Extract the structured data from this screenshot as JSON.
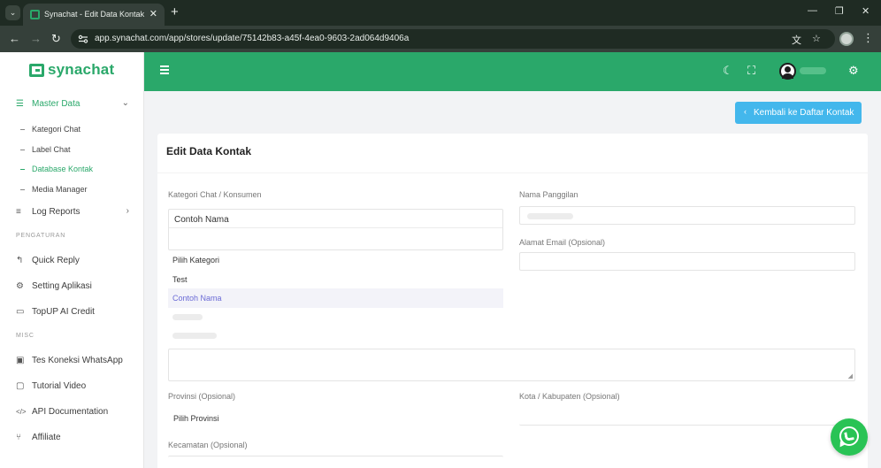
{
  "browser": {
    "tab_title": "Synachat - Edit Data Kontak",
    "url": "app.synachat.com/app/stores/update/75142b83-a45f-4ea0-9603-2ad064d9406a",
    "new_tab": "+",
    "tab_close": "✕",
    "back": "←",
    "forward": "→",
    "reload": "↻",
    "minimize": "—",
    "restore": "❐",
    "close": "✕",
    "menu": "⋮",
    "tab_list": "⌄",
    "translate_icon": "文",
    "bookmark_icon": "☆"
  },
  "brand": {
    "name": "synachat",
    "color": "#2aa86a"
  },
  "sidebar": {
    "master_data": {
      "label": "Master Data",
      "chevron": "⌄"
    },
    "sub_items": [
      {
        "label": "Kategori Chat"
      },
      {
        "label": "Label Chat"
      },
      {
        "label": "Database Kontak"
      },
      {
        "label": "Media Manager"
      }
    ],
    "log_reports": {
      "label": "Log Reports",
      "chevron": "›"
    },
    "section_pengaturan": "PENGATURAN",
    "quick_reply": "Quick Reply",
    "setting_aplikasi": "Setting Aplikasi",
    "topup": "TopUP AI Credit",
    "section_misc": "MISC",
    "tes_koneksi": "Tes Koneksi WhatsApp",
    "tutorial": "Tutorial Video",
    "api_doc": "API Documentation",
    "affiliate": "Affiliate"
  },
  "icons": {
    "master": "☰",
    "log": "≡",
    "quick": "↰",
    "gear": "⚙",
    "card": "▭",
    "chat": "▣",
    "video": "▢",
    "code": "</>",
    "share": "⑂",
    "moon": "☾",
    "fullscreen": "⛶"
  },
  "header": {
    "menu_icon": "hamburger-icon"
  },
  "main": {
    "back_button": "Kembali ke Daftar Kontak",
    "back_arrow": "‹",
    "card_title": "Edit Data Kontak",
    "kategori_label": "Kategori Chat / Konsumen",
    "kategori_value": "Contoh Nama",
    "kategori_options": [
      {
        "label": "Pilih Kategori"
      },
      {
        "label": "Test"
      },
      {
        "label": "Contoh Nama"
      }
    ],
    "nama_label": "Nama Panggilan",
    "email_label": "Alamat Email (Opsional)",
    "provinsi_label": "Provinsi (Opsional)",
    "provinsi_value": "Pilih Provinsi",
    "kota_label": "Kota / Kabupaten (Opsional)",
    "kecamatan_label": "Kecamatan (Opsional)",
    "textarea_grip": "◢"
  }
}
